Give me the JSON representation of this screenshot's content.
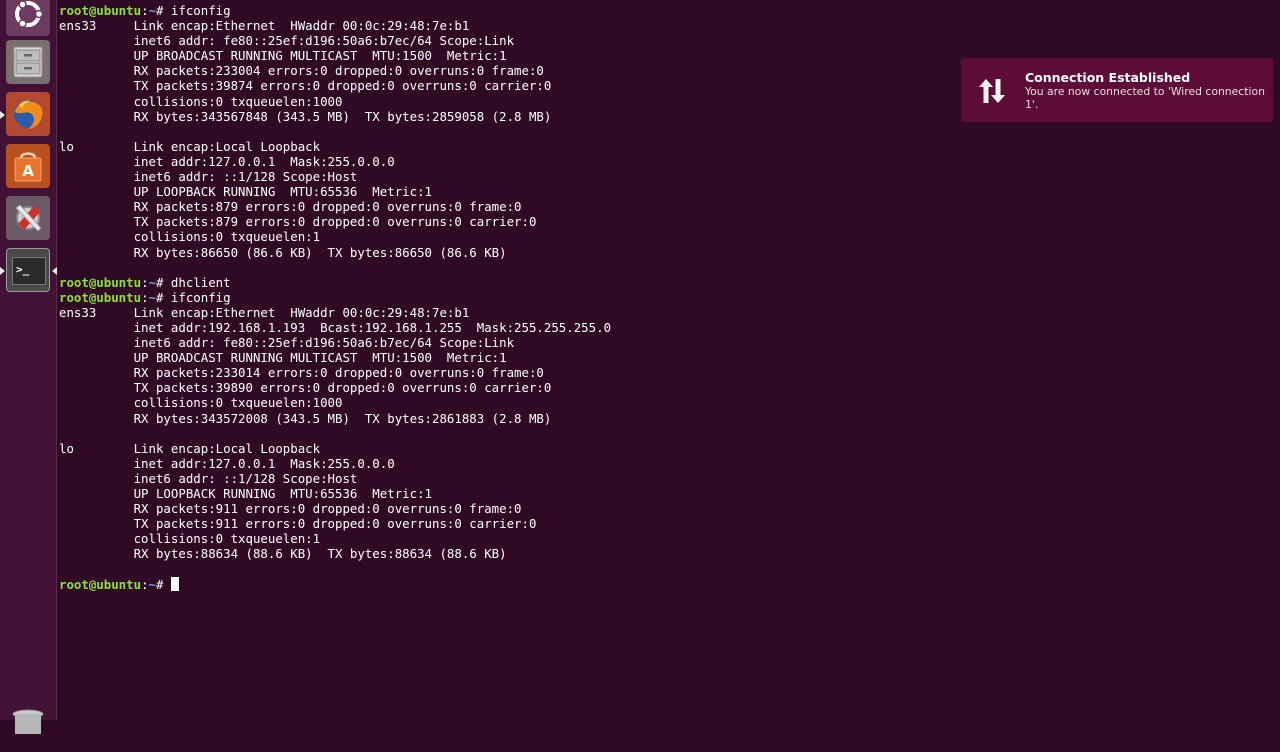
{
  "launcher": {
    "items": [
      {
        "name": "dash-home",
        "icon": "ubuntu-logo-icon"
      },
      {
        "name": "files",
        "icon": "file-cabinet-icon"
      },
      {
        "name": "firefox",
        "icon": "firefox-icon"
      },
      {
        "name": "software-center",
        "icon": "shopping-bag-icon"
      },
      {
        "name": "system-settings",
        "icon": "settings-tools-icon"
      },
      {
        "name": "terminal",
        "icon": "terminal-icon",
        "glyph": ">_"
      },
      {
        "name": "trash",
        "icon": "trash-icon"
      }
    ]
  },
  "colors": {
    "terminal_bg": "#300a24",
    "prompt_user": "#8ae234",
    "prompt_path": "#729fcf",
    "notification_bg": "#5c0c37"
  },
  "terminal": {
    "lines": [
      {
        "type": "prompt",
        "user": "root@ubuntu",
        "path": "~",
        "cmd": "ifconfig"
      },
      {
        "type": "out",
        "text": "ens33     Link encap:Ethernet  HWaddr 00:0c:29:48:7e:b1"
      },
      {
        "type": "out",
        "text": "          inet6 addr: fe80::25ef:d196:50a6:b7ec/64 Scope:Link"
      },
      {
        "type": "out",
        "text": "          UP BROADCAST RUNNING MULTICAST  MTU:1500  Metric:1"
      },
      {
        "type": "out",
        "text": "          RX packets:233004 errors:0 dropped:0 overruns:0 frame:0"
      },
      {
        "type": "out",
        "text": "          TX packets:39874 errors:0 dropped:0 overruns:0 carrier:0"
      },
      {
        "type": "out",
        "text": "          collisions:0 txqueuelen:1000"
      },
      {
        "type": "out",
        "text": "          RX bytes:343567848 (343.5 MB)  TX bytes:2859058 (2.8 MB)"
      },
      {
        "type": "out",
        "text": ""
      },
      {
        "type": "out",
        "text": "lo        Link encap:Local Loopback"
      },
      {
        "type": "out",
        "text": "          inet addr:127.0.0.1  Mask:255.0.0.0"
      },
      {
        "type": "out",
        "text": "          inet6 addr: ::1/128 Scope:Host"
      },
      {
        "type": "out",
        "text": "          UP LOOPBACK RUNNING  MTU:65536  Metric:1"
      },
      {
        "type": "out",
        "text": "          RX packets:879 errors:0 dropped:0 overruns:0 frame:0"
      },
      {
        "type": "out",
        "text": "          TX packets:879 errors:0 dropped:0 overruns:0 carrier:0"
      },
      {
        "type": "out",
        "text": "          collisions:0 txqueuelen:1"
      },
      {
        "type": "out",
        "text": "          RX bytes:86650 (86.6 KB)  TX bytes:86650 (86.6 KB)"
      },
      {
        "type": "out",
        "text": ""
      },
      {
        "type": "prompt",
        "user": "root@ubuntu",
        "path": "~",
        "cmd": "dhclient"
      },
      {
        "type": "prompt",
        "user": "root@ubuntu",
        "path": "~",
        "cmd": "ifconfig"
      },
      {
        "type": "out",
        "text": "ens33     Link encap:Ethernet  HWaddr 00:0c:29:48:7e:b1"
      },
      {
        "type": "out",
        "text": "          inet addr:192.168.1.193  Bcast:192.168.1.255  Mask:255.255.255.0"
      },
      {
        "type": "out",
        "text": "          inet6 addr: fe80::25ef:d196:50a6:b7ec/64 Scope:Link"
      },
      {
        "type": "out",
        "text": "          UP BROADCAST RUNNING MULTICAST  MTU:1500  Metric:1"
      },
      {
        "type": "out",
        "text": "          RX packets:233014 errors:0 dropped:0 overruns:0 frame:0"
      },
      {
        "type": "out",
        "text": "          TX packets:39890 errors:0 dropped:0 overruns:0 carrier:0"
      },
      {
        "type": "out",
        "text": "          collisions:0 txqueuelen:1000"
      },
      {
        "type": "out",
        "text": "          RX bytes:343572008 (343.5 MB)  TX bytes:2861883 (2.8 MB)"
      },
      {
        "type": "out",
        "text": ""
      },
      {
        "type": "out",
        "text": "lo        Link encap:Local Loopback"
      },
      {
        "type": "out",
        "text": "          inet addr:127.0.0.1  Mask:255.0.0.0"
      },
      {
        "type": "out",
        "text": "          inet6 addr: ::1/128 Scope:Host"
      },
      {
        "type": "out",
        "text": "          UP LOOPBACK RUNNING  MTU:65536  Metric:1"
      },
      {
        "type": "out",
        "text": "          RX packets:911 errors:0 dropped:0 overruns:0 frame:0"
      },
      {
        "type": "out",
        "text": "          TX packets:911 errors:0 dropped:0 overruns:0 carrier:0"
      },
      {
        "type": "out",
        "text": "          collisions:0 txqueuelen:1"
      },
      {
        "type": "out",
        "text": "          RX bytes:88634 (88.6 KB)  TX bytes:88634 (88.6 KB)"
      },
      {
        "type": "out",
        "text": ""
      },
      {
        "type": "prompt",
        "user": "root@ubuntu",
        "path": "~",
        "cmd": "",
        "cursor": true
      }
    ]
  },
  "notification": {
    "icon": "network-transfer-icon",
    "title": "Connection Established",
    "body": "You are now connected to 'Wired connection 1'."
  }
}
